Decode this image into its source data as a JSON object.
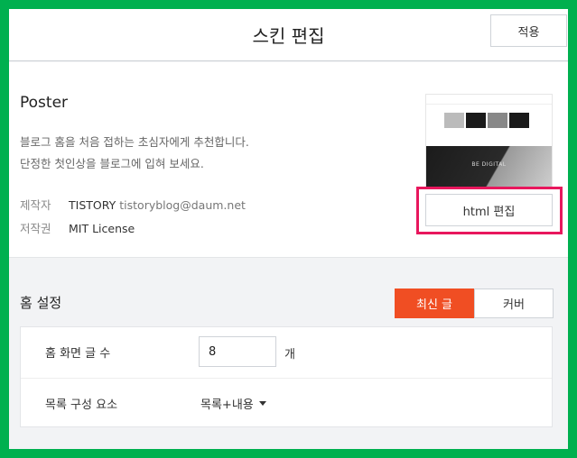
{
  "header": {
    "title": "스킨 편집",
    "apply_label": "적용"
  },
  "skin": {
    "name": "Poster",
    "description_lines": [
      "블로그 홈을 처음 접하는 초심자에게 추천합니다.",
      "단정한 첫인상을 블로그에 입혀 보세요."
    ],
    "maker_label": "제작자",
    "maker_name": "TISTORY",
    "maker_email": "tistoryblog@daum.net",
    "license_label": "저작권",
    "license_value": "MIT License",
    "thumbnail_caption": "BE DIGITAL",
    "html_edit_label": "html 편집"
  },
  "home_settings": {
    "title": "홈 설정",
    "tabs": [
      {
        "label": "최신 글",
        "active": true
      },
      {
        "label": "커버",
        "active": false
      }
    ],
    "post_count_label": "홈 화면 글 수",
    "post_count_value": "8",
    "post_count_unit": "개",
    "list_composition_label": "목록 구성 요소",
    "list_composition_value": "목록+내용"
  },
  "colors": {
    "frame": "#00b04f",
    "accent": "#f04e23",
    "highlight": "#e8175d"
  }
}
